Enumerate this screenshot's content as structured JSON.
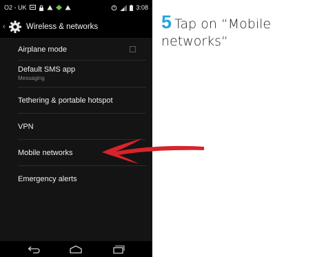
{
  "status_bar": {
    "carrier": "O2 - UK",
    "time": "3:08"
  },
  "action_bar": {
    "title": "Wireless & networks",
    "icon": "gear-icon"
  },
  "settings": {
    "items": [
      {
        "label": "Airplane mode",
        "sub": "",
        "has_checkbox": true,
        "checked": false
      },
      {
        "label": "Default SMS app",
        "sub": "Messaging"
      },
      {
        "label": "Tethering & portable hotspot",
        "sub": ""
      },
      {
        "label": "VPN",
        "sub": ""
      },
      {
        "label": "Mobile networks",
        "sub": ""
      },
      {
        "label": "Emergency alerts",
        "sub": ""
      }
    ]
  },
  "instruction": {
    "step": "5",
    "text": "Tap on “Mobile networks“"
  },
  "colors": {
    "accent": "#2aa3da",
    "arrow": "#d8232a",
    "screen_bg": "#141414"
  }
}
